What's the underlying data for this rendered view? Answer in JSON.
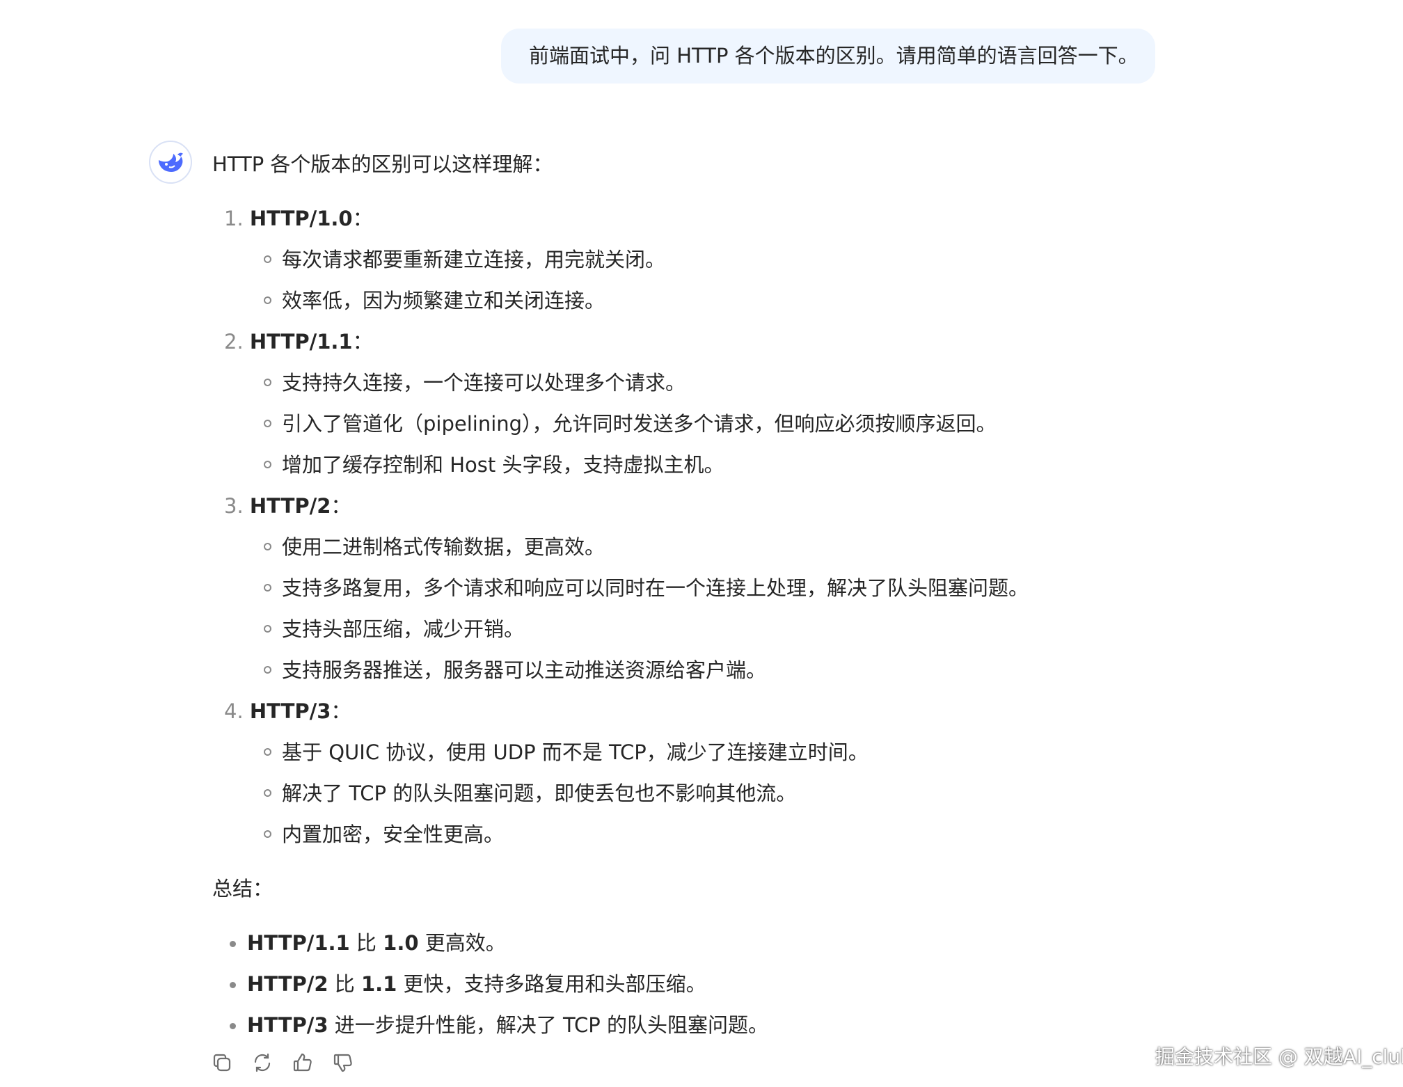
{
  "user_message": {
    "text": "前端面试中，问 HTTP 各个版本的区别。请用简单的语言回答一下。"
  },
  "assistant": {
    "avatar_icon": "deepseek-whale-logo",
    "intro": "HTTP 各个版本的区别可以这样理解：",
    "sections": [
      {
        "num": "1.",
        "title": "HTTP/1.0",
        "colon": "：",
        "items": [
          "每次请求都要重新建立连接，用完就关闭。",
          "效率低，因为频繁建立和关闭连接。"
        ]
      },
      {
        "num": "2.",
        "title": "HTTP/1.1",
        "colon": "：",
        "items": [
          "支持持久连接，一个连接可以处理多个请求。",
          "引入了管道化（pipelining），允许同时发送多个请求，但响应必须按顺序返回。",
          "增加了缓存控制和 Host 头字段，支持虚拟主机。"
        ]
      },
      {
        "num": "3.",
        "title": "HTTP/2",
        "colon": "：",
        "items": [
          "使用二进制格式传输数据，更高效。",
          "支持多路复用，多个请求和响应可以同时在一个连接上处理，解决了队头阻塞问题。",
          "支持头部压缩，减少开销。",
          "支持服务器推送，服务器可以主动推送资源给客户端。"
        ]
      },
      {
        "num": "4.",
        "title": "HTTP/3",
        "colon": "：",
        "items": [
          "基于 QUIC 协议，使用 UDP 而不是 TCP，减少了连接建立时间。",
          "解决了 TCP 的队头阻塞问题，即使丢包也不影响其他流。",
          "内置加密，安全性更高。"
        ]
      }
    ],
    "summary_label": "总结：",
    "summary": [
      {
        "b1": "HTTP/1.1",
        "t1": " 比 ",
        "b2": "1.0",
        "t2": " 更高效。"
      },
      {
        "b1": "HTTP/2",
        "t1": " 比 ",
        "b2": "1.1",
        "t2": " 更快，支持多路复用和头部压缩。"
      },
      {
        "b1": "HTTP/3",
        "t1": " 进一步提升性能，解决了 TCP 的队头阻塞问题。",
        "b2": "",
        "t2": ""
      }
    ]
  },
  "actions": [
    {
      "name": "copy-icon"
    },
    {
      "name": "regenerate-icon"
    },
    {
      "name": "thumbs-up-icon"
    },
    {
      "name": "thumbs-down-icon"
    }
  ],
  "watermark": "掘金技术社区 @ 双越AI_club",
  "colors": {
    "user_bubble_bg": "#eff6ff",
    "brand_blue": "#4d6bfe",
    "text": "#262626",
    "muted": "#8a8a8a"
  }
}
